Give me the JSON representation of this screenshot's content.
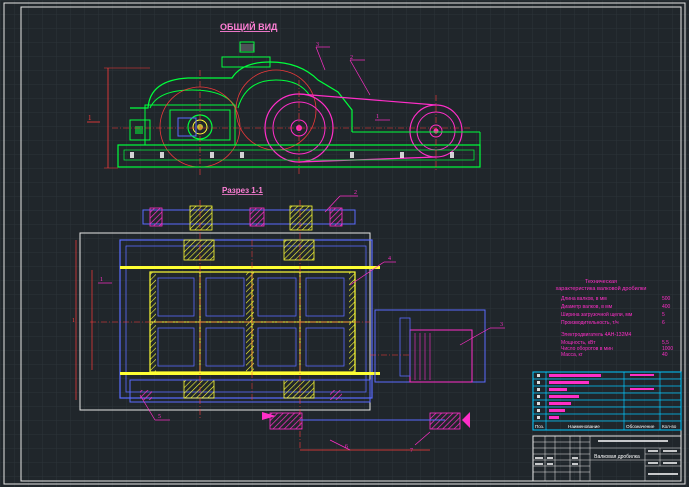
{
  "drawing": {
    "general_view_title": "ОБЩИЙ ВИД",
    "section_title": "Разрез 1-1",
    "section_marks": [
      "1",
      "1"
    ],
    "leader_numbers": [
      "3",
      "2",
      "1",
      "1",
      "2",
      "3",
      "4",
      "5",
      "6",
      "7",
      "8",
      "9"
    ]
  },
  "specs": {
    "heading_line1": "Техническая",
    "heading_line2": "характеристика валковой дробилки",
    "rows": [
      {
        "label": "Длина валков, в  мм",
        "value": "500"
      },
      {
        "label": "Диаметр валков, в  мм",
        "value": "400"
      },
      {
        "label": "Ширина загрузочной щели, мм",
        "value": "5"
      },
      {
        "label": "Производительность, т/ч",
        "value": "6"
      }
    ],
    "motor_heading": "Электродвигатель  4АН-132М4",
    "motor_rows": [
      {
        "label": "Мощность,  кВт",
        "value": "5,5"
      },
      {
        "label": "Число оборотов в  мин",
        "value": "1000"
      },
      {
        "label": "Масса, кг",
        "value": "40"
      }
    ]
  },
  "parts_table": {
    "headers": [
      "Поз.",
      "Наименование",
      "Обозначение",
      "Кол-во"
    ]
  },
  "title_block": {
    "name": "Валковая дробилка"
  },
  "colors": {
    "background": "#20262b",
    "grid": "#2c343a",
    "frame": "#e6e6e6",
    "table": "#00c8ff",
    "part_green": "#00ff3c",
    "part_magenta": "#ff2ec8",
    "part_yellow": "#ffff33",
    "part_blue": "#5a6bff",
    "dimension_red": "#ff3b3b",
    "text_pink": "#ff7fd6"
  }
}
